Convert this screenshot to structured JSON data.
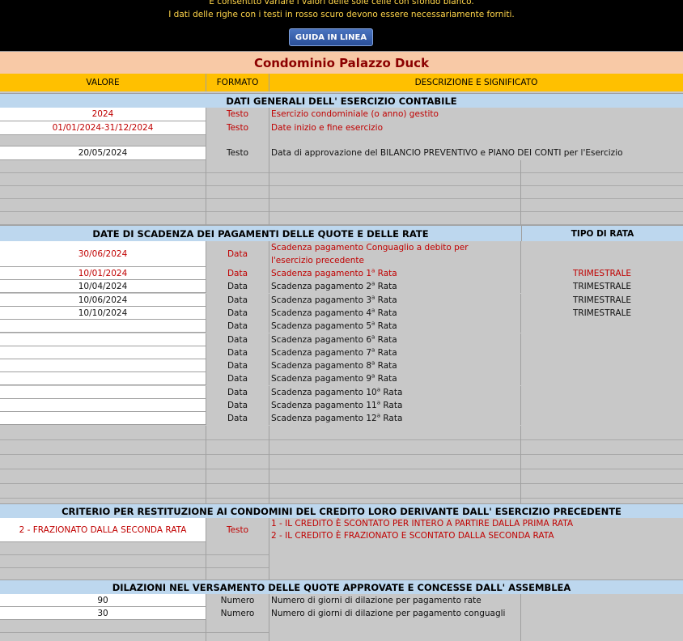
{
  "banner": {
    "line1": "È consentito variare i valori delle sole celle con sfondo bianco.",
    "line2": "I dati delle righe con i testi in rosso scuro devono essere necessariamente forniti.",
    "help_button": "GUIDA IN LINEA"
  },
  "title": "Condominio Palazzo Duck",
  "columns": {
    "valore": "VALORE",
    "formato": "FORMATO",
    "descrizione": "DESCRIZIONE E SIGNIFICATO"
  },
  "section1": {
    "title": "DATI GENERALI DELL' ESERCIZIO CONTABILE",
    "rows": [
      {
        "value": "2024",
        "format": "Testo",
        "desc": "Esercizio condominiale (o anno) gestito"
      },
      {
        "value": "01/01/2024-31/12/2024",
        "format": "Testo",
        "desc": "Date inizio e fine esercizio"
      },
      {
        "value": "20/05/2024",
        "format": "Testo",
        "desc": "Data di approvazione del BILANCIO PREVENTIVO e PIANO DEI CONTI per l'Esercizio"
      }
    ]
  },
  "section2": {
    "title": "DATE DI SCADENZA DEI PAGAMENTI DELLE QUOTE E DELLE RATE",
    "tipo_header": "TIPO DI RATA",
    "conguaglio": {
      "value": "30/06/2024",
      "format": "Data",
      "desc1": "Scadenza pagamento Conguaglio a debito per",
      "desc2": "l'esercizio precedente"
    },
    "rate": [
      {
        "value": "10/01/2024",
        "format": "Data",
        "desc": "Scadenza pagamento 1",
        "sup": "a",
        "suffix": " Rata",
        "tipo": "TRIMESTRALE"
      },
      {
        "value": "10/04/2024",
        "format": "Data",
        "desc": "Scadenza pagamento 2",
        "sup": "a",
        "suffix": " Rata",
        "tipo": "TRIMESTRALE"
      },
      {
        "value": "10/06/2024",
        "format": "Data",
        "desc": "Scadenza pagamento 3",
        "sup": "a",
        "suffix": " Rata",
        "tipo": "TRIMESTRALE"
      },
      {
        "value": "10/10/2024",
        "format": "Data",
        "desc": "Scadenza pagamento 4",
        "sup": "a",
        "suffix": " Rata",
        "tipo": "TRIMESTRALE"
      },
      {
        "value": "",
        "format": "Data",
        "desc": "Scadenza pagamento 5",
        "sup": "a",
        "suffix": " Rata",
        "tipo": ""
      },
      {
        "value": "",
        "format": "Data",
        "desc": "Scadenza pagamento 6",
        "sup": "a",
        "suffix": " Rata",
        "tipo": ""
      },
      {
        "value": "",
        "format": "Data",
        "desc": "Scadenza pagamento 7",
        "sup": "a",
        "suffix": " Rata",
        "tipo": ""
      },
      {
        "value": "",
        "format": "Data",
        "desc": "Scadenza pagamento 8",
        "sup": "a",
        "suffix": " Rata",
        "tipo": ""
      },
      {
        "value": "",
        "format": "Data",
        "desc": "Scadenza pagamento 9",
        "sup": "a",
        "suffix": " Rata",
        "tipo": ""
      },
      {
        "value": "",
        "format": "Data",
        "desc": "Scadenza pagamento 10",
        "sup": "a",
        "suffix": " Rata",
        "tipo": ""
      },
      {
        "value": "",
        "format": "Data",
        "desc": "Scadenza pagamento 11",
        "sup": "a",
        "suffix": " Rata",
        "tipo": ""
      },
      {
        "value": "",
        "format": "Data",
        "desc": "Scadenza pagamento 12",
        "sup": "a",
        "suffix": " Rata",
        "tipo": ""
      }
    ]
  },
  "section3": {
    "title": "CRITERIO PER RESTITUZIONE AI CONDOMINI DEL CREDITO LORO DERIVANTE DALL' ESERCIZIO PRECEDENTE",
    "value": "2 - FRAZIONATO DALLA SECONDA RATA",
    "format": "Testo",
    "desc1": "1 - IL CREDITO È SCONTATO PER INTERO A PARTIRE DALLA PRIMA RATA",
    "desc2": "2 - IL CREDITO È FRAZIONATO E SCONTATO DALLA SECONDA RATA"
  },
  "section4": {
    "title": "DILAZIONI NEL VERSAMENTO DELLE QUOTE APPROVATE E CONCESSE DALL' ASSEMBLEA",
    "rows": [
      {
        "value": "90",
        "format": "Numero",
        "desc": "Numero di giorni di dilazione per pagamento rate"
      },
      {
        "value": "30",
        "format": "Numero",
        "desc": "Numero di giorni di dilazione per pagamento conguagli"
      }
    ]
  }
}
